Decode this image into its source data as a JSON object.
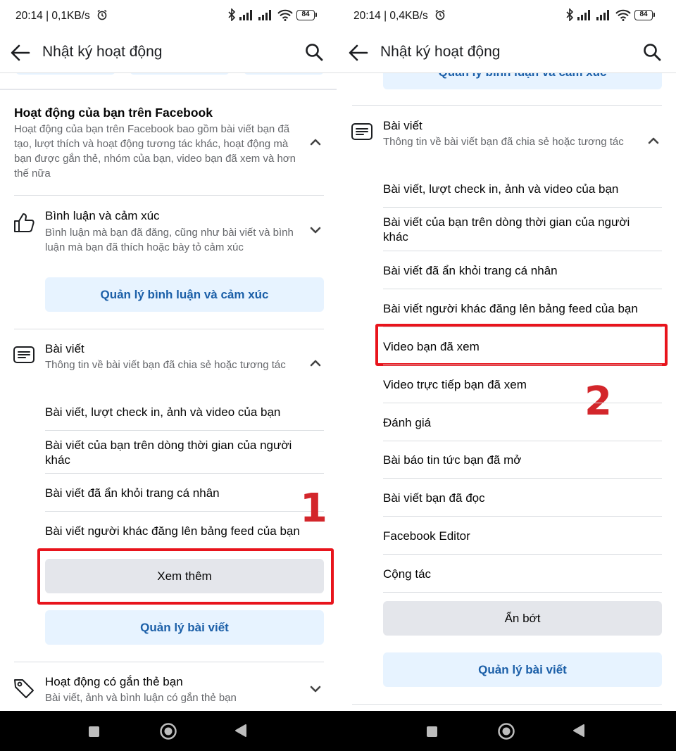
{
  "colors": {
    "accent": "#1b5fa8",
    "blue_button_bg": "#e7f3ff",
    "gray_button_bg": "#e4e6eb",
    "annotation_red": "#e8141c",
    "nav_bar": "#000000"
  },
  "left": {
    "status": {
      "time": "20:14 | 0,1KB/s",
      "battery": "84"
    },
    "app_bar": {
      "title": "Nhật ký hoạt động"
    },
    "top_partial_button": "",
    "facebook_activity": {
      "title": "Hoạt động của bạn trên Facebook",
      "desc": "Hoạt động của bạn trên Facebook bao gồm bài viết bạn đã tạo, lượt thích và hoạt động tương tác khác, hoạt động mà bạn được gắn thẻ, nhóm của bạn, video bạn đã xem và hơn thế nữa"
    },
    "comments": {
      "title": "Bình luận và cảm xúc",
      "desc": "Bình luận mà bạn đã đăng, cũng như bài viết và bình luận mà bạn đã thích hoặc bày tỏ cảm xúc",
      "button": "Quản lý bình luận và cảm xúc"
    },
    "posts": {
      "title": "Bài viết",
      "desc": "Thông tin về bài viết bạn đã chia sẻ hoặc tương tác",
      "items": [
        "Bài viết, lượt check in, ảnh và video của bạn",
        "Bài viết của bạn trên dòng thời gian của người khác",
        "Bài viết đã ẩn khỏi trang cá nhân",
        "Bài viết người khác đăng lên bảng feed của bạn"
      ],
      "see_more": "Xem thêm",
      "manage": "Quản lý bài viết"
    },
    "tagged": {
      "title": "Hoạt động có gắn thẻ bạn",
      "desc": "Bài viết, ảnh và bình luận có gắn thẻ bạn"
    },
    "annotation": "1"
  },
  "right": {
    "status": {
      "time": "20:14 | 0,4KB/s",
      "battery": "84"
    },
    "app_bar": {
      "title": "Nhật ký hoạt động"
    },
    "top_partial_button": "Quản lý bình luận và cảm xúc",
    "posts": {
      "title": "Bài viết",
      "desc": "Thông tin về bài viết bạn đã chia sẻ hoặc tương tác",
      "items": [
        "Bài viết, lượt check in, ảnh và video của bạn",
        "Bài viết của bạn trên dòng thời gian của người khác",
        "Bài viết đã ẩn khỏi trang cá nhân",
        "Bài viết người khác đăng lên bảng feed của bạn",
        "Video bạn đã xem",
        "Video trực tiếp bạn đã xem",
        "Đánh giá",
        "Bài báo tin tức bạn đã mở",
        "Bài viết bạn đã đọc",
        "Facebook Editor",
        "Cộng tác"
      ],
      "see_less": "Ẩn bớt",
      "manage": "Quản lý bài viết"
    },
    "annotation": "2"
  },
  "nav": {
    "icons": [
      "recents-square-icon",
      "home-circle-icon",
      "back-triangle-icon"
    ]
  }
}
